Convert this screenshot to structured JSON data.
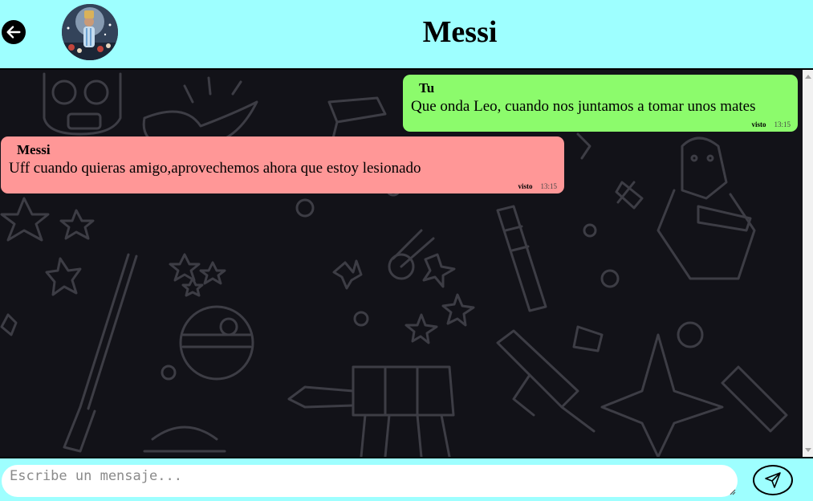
{
  "header": {
    "contact_name": "Messi",
    "back_icon": "arrow-left-icon",
    "avatar": "contact-avatar"
  },
  "messages": [
    {
      "direction": "sent",
      "sender": "Tu",
      "text": "Que onda Leo, cuando nos juntamos a tomar unos mates",
      "status": "visto",
      "time": "13:15",
      "color": "#8cfb6c"
    },
    {
      "direction": "received",
      "sender": "Messi",
      "text": "Uff cuando quieras amigo,aprovechemos ahora que estoy lesionado",
      "status": "visto",
      "time": "13:15",
      "color": "#ff9797"
    }
  ],
  "composer": {
    "placeholder": "Escribe un mensaje...",
    "value": "",
    "send_icon": "send-icon"
  },
  "colors": {
    "header_bg": "#9effff",
    "chat_bg": "#121218"
  }
}
